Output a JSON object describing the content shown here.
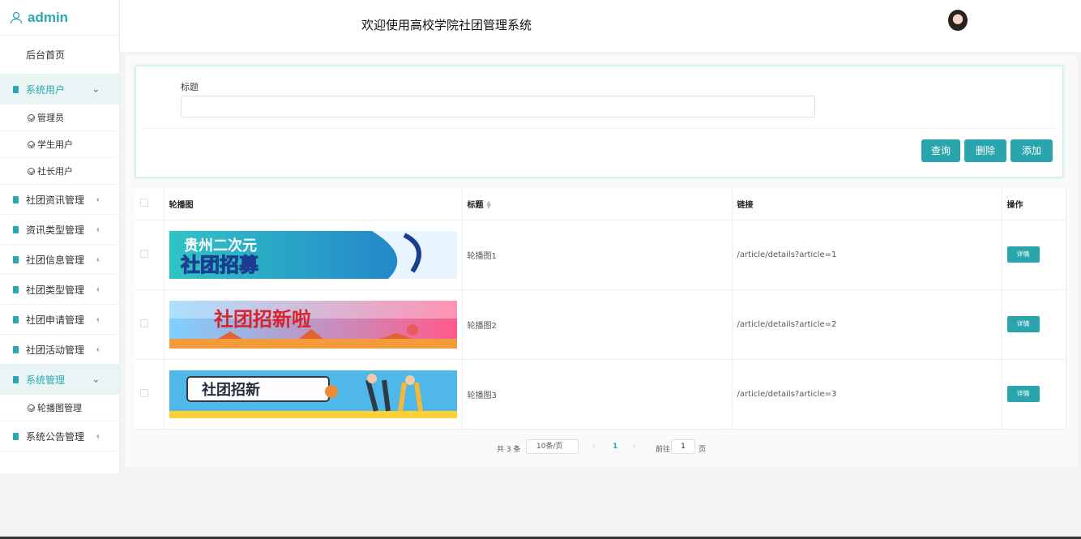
{
  "brand": {
    "name": "admin"
  },
  "header": {
    "title": "欢迎使用高校学院社团管理系统"
  },
  "sidebar": {
    "home": "后台首页",
    "items": [
      {
        "label": "系统用户",
        "open": true,
        "arrow": "⌄",
        "children": [
          "管理员",
          "学生用户",
          "社长用户"
        ]
      },
      {
        "label": "社团资讯管理",
        "arrow": "‹"
      },
      {
        "label": "资讯类型管理",
        "arrow": "‹"
      },
      {
        "label": "社团信息管理",
        "arrow": "‹"
      },
      {
        "label": "社团类型管理",
        "arrow": "‹"
      },
      {
        "label": "社团申请管理",
        "arrow": "‹"
      },
      {
        "label": "社团活动管理",
        "arrow": "‹"
      },
      {
        "label": "系统管理",
        "open": true,
        "arrow": "⌄",
        "children": [
          "轮播图管理"
        ]
      },
      {
        "label": "系统公告管理",
        "arrow": "‹"
      }
    ]
  },
  "search": {
    "label": "标题",
    "value": "",
    "placeholder": ""
  },
  "buttons": {
    "query": "查询",
    "delete": "删除",
    "add": "添加"
  },
  "table": {
    "headers": {
      "image": "轮播图",
      "title": "标题",
      "link": "链接",
      "action": "操作"
    },
    "rows": [
      {
        "title": "轮播图1",
        "link": "/article/details?article=1",
        "action": "详情",
        "banner_text": [
          "贵州二次元",
          "社团招募"
        ],
        "banner_colors": [
          "#2ec4c6",
          "#2178c9"
        ]
      },
      {
        "title": "轮播图2",
        "link": "/article/details?article=2",
        "action": "详情",
        "banner_text": [
          "社团招新啦"
        ],
        "banner_colors": [
          "#7fd0ff",
          "#ff5a8a"
        ]
      },
      {
        "title": "轮播图3",
        "link": "/article/details?article=3",
        "action": "详情",
        "banner_text": [
          "社团招新"
        ],
        "banner_colors": [
          "#4fb8e8",
          "#ffd033"
        ]
      }
    ]
  },
  "pagination": {
    "total": "共 3 条",
    "page_size": "10条/页",
    "current": "1",
    "goto_label": "前往",
    "goto_value": "1",
    "page_suffix": "页"
  },
  "colors": {
    "accent": "#2aa5ad"
  }
}
